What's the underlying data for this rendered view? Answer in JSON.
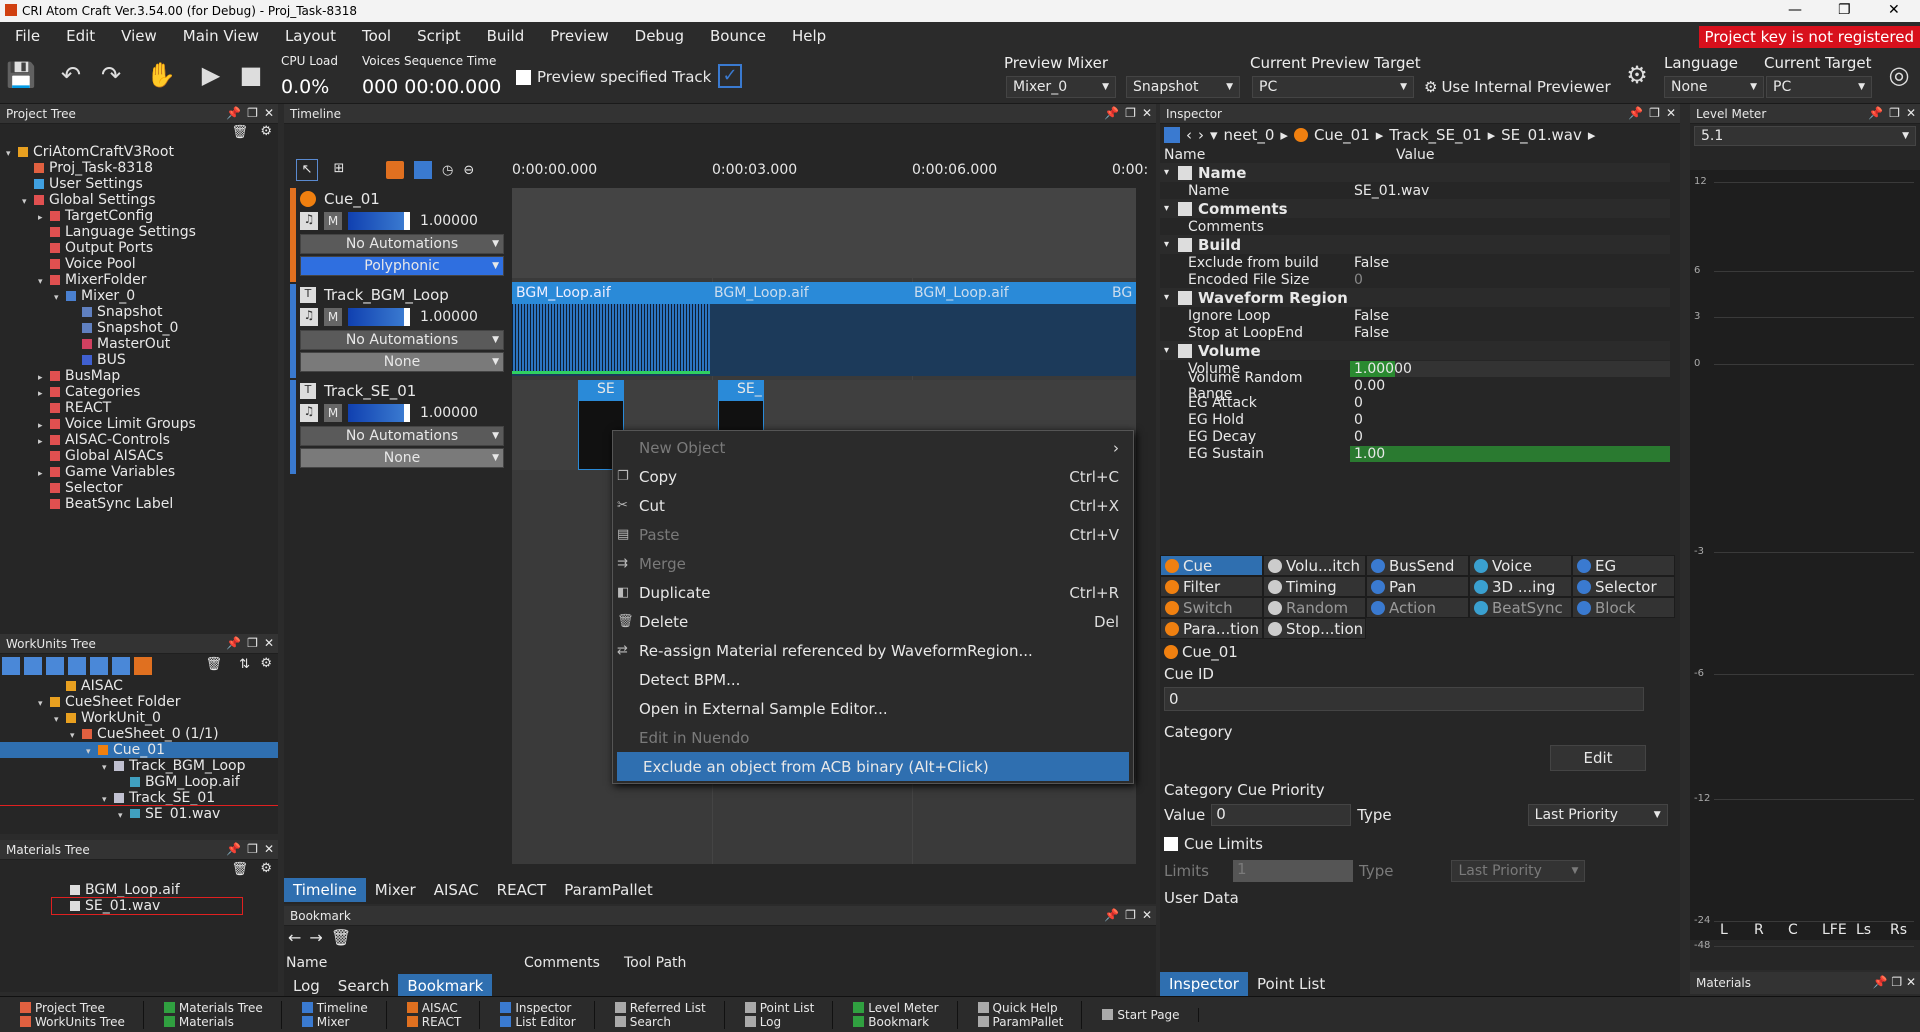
{
  "title": "CRI Atom Craft Ver.3.54.00 (for Debug) - Proj_Task-8318",
  "menu": [
    "File",
    "Edit",
    "View",
    "Main View",
    "Layout",
    "Tool",
    "Script",
    "Build",
    "Preview",
    "Debug",
    "Bounce",
    "Help"
  ],
  "warning": "Project key is not registered",
  "toolbar": {
    "cpu_label": "CPU Load",
    "cpu_value": "0.0%",
    "voices_label": "Voices Sequence Time",
    "voices_value": "000 00:00.000",
    "preview_track": "Preview specified Track",
    "preview_mixer_label": "Preview Mixer",
    "mixer": "Mixer_0",
    "snapshot": "Snapshot",
    "current_preview_label": "Current Preview Target",
    "preview_target": "PC",
    "use_internal": "Use Internal Previewer",
    "language_label": "Language",
    "language": "None",
    "current_target_label": "Current Target",
    "target": "PC"
  },
  "project_tree": {
    "title": "Project Tree",
    "items": [
      {
        "t": "CriAtomCraftV3Root",
        "lvl": 0,
        "exp": "▾",
        "c": "#e8a020"
      },
      {
        "t": "Proj_Task-8318",
        "lvl": 1,
        "exp": "",
        "c": "#e06040"
      },
      {
        "t": "User Settings",
        "lvl": 1,
        "exp": "",
        "c": "#40a0e0"
      },
      {
        "t": "Global Settings",
        "lvl": 1,
        "exp": "▾",
        "c": "#e05050"
      },
      {
        "t": "TargetConfig",
        "lvl": 2,
        "exp": "▸",
        "c": "#e05050"
      },
      {
        "t": "Language Settings",
        "lvl": 2,
        "exp": "",
        "c": "#e05050"
      },
      {
        "t": "Output Ports",
        "lvl": 2,
        "exp": "",
        "c": "#e05050"
      },
      {
        "t": "Voice Pool",
        "lvl": 2,
        "exp": "",
        "c": "#e05050"
      },
      {
        "t": "MixerFolder",
        "lvl": 2,
        "exp": "▾",
        "c": "#e05050"
      },
      {
        "t": "Mixer_0",
        "lvl": 3,
        "exp": "▾",
        "c": "#4a80d0"
      },
      {
        "t": "Snapshot",
        "lvl": 4,
        "exp": "",
        "c": "#6080c0"
      },
      {
        "t": "Snapshot_0",
        "lvl": 4,
        "exp": "",
        "c": "#6080c0"
      },
      {
        "t": "MasterOut",
        "lvl": 4,
        "exp": "",
        "c": "#d04060"
      },
      {
        "t": "BUS",
        "lvl": 4,
        "exp": "",
        "c": "#4060d0"
      },
      {
        "t": "BusMap",
        "lvl": 2,
        "exp": "▸",
        "c": "#e05050"
      },
      {
        "t": "Categories",
        "lvl": 2,
        "exp": "▸",
        "c": "#e05050"
      },
      {
        "t": "REACT",
        "lvl": 2,
        "exp": "",
        "c": "#e05050"
      },
      {
        "t": "Voice Limit Groups",
        "lvl": 2,
        "exp": "▸",
        "c": "#e05050"
      },
      {
        "t": "AISAC-Controls",
        "lvl": 2,
        "exp": "▸",
        "c": "#e05050"
      },
      {
        "t": "Global AISACs",
        "lvl": 2,
        "exp": "",
        "c": "#e05050"
      },
      {
        "t": "Game Variables",
        "lvl": 2,
        "exp": "▸",
        "c": "#e05050"
      },
      {
        "t": "Selector",
        "lvl": 2,
        "exp": "",
        "c": "#e05050"
      },
      {
        "t": "BeatSync Label",
        "lvl": 2,
        "exp": "",
        "c": "#e05050"
      }
    ]
  },
  "workunits_tree": {
    "title": "WorkUnits Tree",
    "items": [
      {
        "t": "AISAC",
        "lvl": 3,
        "exp": "",
        "c": "#e8a020",
        "sel": false
      },
      {
        "t": "CueSheet Folder",
        "lvl": 2,
        "exp": "▾",
        "c": "#e8a020",
        "sel": false
      },
      {
        "t": "WorkUnit_0",
        "lvl": 3,
        "exp": "▾",
        "c": "#e8a020",
        "sel": false
      },
      {
        "t": "CueSheet_0 (1/1)",
        "lvl": 4,
        "exp": "▾",
        "c": "#e06040",
        "sel": false
      },
      {
        "t": "Cue_01",
        "lvl": 5,
        "exp": "▾",
        "c": "#f08010",
        "sel": true
      },
      {
        "t": "Track_BGM_Loop",
        "lvl": 6,
        "exp": "▾",
        "c": "#c0c0d0",
        "sel": false
      },
      {
        "t": "BGM_Loop.aif",
        "lvl": 7,
        "exp": "",
        "c": "#40a0c0",
        "sel": false
      },
      {
        "t": "Track_SE_01",
        "lvl": 6,
        "exp": "▾",
        "c": "#c0c0d0",
        "sel": false
      },
      {
        "t": "SE_01.wav",
        "lvl": 7,
        "exp": "▾",
        "c": "#40a0c0",
        "sel": false
      }
    ]
  },
  "materials_tree": {
    "title": "Materials Tree",
    "items": [
      "BGM_Loop.aif",
      "SE_01.wav"
    ]
  },
  "timeline": {
    "title": "Timeline",
    "times": [
      "0:00:00.000",
      "0:00:03.000",
      "0:00:06.000",
      "0:00:"
    ],
    "tracks": [
      {
        "name": "Cue_01",
        "vol": "1.00000",
        "auto": "No Automations",
        "mode": "Polyphonic"
      },
      {
        "name": "Track_BGM_Loop",
        "vol": "1.00000",
        "auto": "No Automations",
        "mode": "None"
      },
      {
        "name": "Track_SE_01",
        "vol": "1.00000",
        "auto": "No Automations",
        "mode": "None"
      }
    ],
    "clips": [
      "BGM_Loop.aif",
      "BGM_Loop.aif",
      "BGM_Loop.aif",
      "BG"
    ],
    "se_clips": [
      "SE",
      "SE_"
    ],
    "mute": "M",
    "tabs": [
      "Timeline",
      "Mixer",
      "AISAC",
      "REACT",
      "ParamPallet"
    ]
  },
  "context_menu": [
    {
      "label": "New Object",
      "sc": "›",
      "dis": true,
      "ic": ""
    },
    {
      "label": "Copy",
      "sc": "Ctrl+C",
      "dis": false,
      "ic": "❐"
    },
    {
      "label": "Cut",
      "sc": "Ctrl+X",
      "dis": false,
      "ic": "✂"
    },
    {
      "label": "Paste",
      "sc": "Ctrl+V",
      "dis": true,
      "ic": "▤"
    },
    {
      "label": "Merge",
      "sc": "",
      "dis": true,
      "ic": "⇉"
    },
    {
      "label": "Duplicate",
      "sc": "Ctrl+R",
      "dis": false,
      "ic": "◧"
    },
    {
      "label": "Delete",
      "sc": "Del",
      "dis": false,
      "ic": "🗑"
    },
    {
      "label": "Re-assign Material referenced by WaveformRegion...",
      "sc": "",
      "dis": false,
      "ic": "⇄"
    },
    {
      "label": "Detect BPM...",
      "sc": "",
      "dis": false,
      "ic": ""
    },
    {
      "label": "Open in External Sample Editor...",
      "sc": "",
      "dis": false,
      "ic": ""
    },
    {
      "label": "Edit in Nuendo",
      "sc": "",
      "dis": true,
      "ic": ""
    },
    {
      "label": "Exclude an object from ACB binary (Alt+Click)",
      "sc": "",
      "dis": false,
      "ic": "",
      "hl": true
    }
  ],
  "bookmark": {
    "title": "Bookmark",
    "cols": [
      "Name",
      "Comments",
      "Tool Path"
    ],
    "tabs": [
      "Log",
      "Search",
      "Bookmark"
    ]
  },
  "inspector": {
    "title": "Inspector",
    "crumbs": [
      "neet_0",
      "Cue_01",
      "Track_SE_01",
      "SE_01.wav"
    ],
    "col_name": "Name",
    "col_value": "Value",
    "sections": [
      {
        "h": "Name",
        "rows": [
          [
            "Name",
            "SE_01.wav",
            ""
          ]
        ]
      },
      {
        "h": "Comments",
        "rows": [
          [
            "Comments",
            "",
            ""
          ]
        ]
      },
      {
        "h": "Build",
        "rows": [
          [
            "Exclude from build",
            "False",
            ""
          ],
          [
            "Encoded File Size",
            "0",
            "dim"
          ]
        ]
      },
      {
        "h": "Waveform Region",
        "rows": [
          [
            "Ignore Loop",
            "False",
            ""
          ],
          [
            "Stop at LoopEnd",
            "False",
            ""
          ]
        ]
      },
      {
        "h": "Volume",
        "rows": [
          [
            "Volume",
            "1.00000",
            "green"
          ],
          [
            "Volume Random Range",
            "0.00",
            ""
          ],
          [
            "EG Attack",
            "0",
            ""
          ],
          [
            "EG Hold",
            "0",
            ""
          ],
          [
            "EG Decay",
            "0",
            ""
          ],
          [
            "EG Sustain",
            "1.00",
            "green2"
          ]
        ]
      }
    ],
    "cats": [
      [
        "Cue",
        "Volu...itch",
        "BusSend",
        "Voice",
        "EG"
      ],
      [
        "Filter",
        "Timing",
        "Pan",
        "3D ...ing",
        "Selector"
      ],
      [
        "Switch",
        "Random",
        "Action",
        "BeatSync",
        "Block"
      ],
      [
        "Para...tion",
        "Stop...tion",
        "",
        "",
        ""
      ]
    ],
    "cue_name": "Cue_01",
    "cue_id_label": "Cue ID",
    "cue_id": "0",
    "category_label": "Category",
    "edit": "Edit",
    "cat_priority_label": "Category Cue Priority",
    "value_label": "Value",
    "value": "0",
    "type_label": "Type",
    "type": "Last Priority",
    "cue_limits": "Cue Limits",
    "limits_label": "Limits",
    "limits": "1",
    "type2": "Last Priority",
    "user_data": "User Data",
    "tabs": [
      "Inspector",
      "Point List"
    ]
  },
  "level_meter": {
    "title": "Level Meter",
    "mode": "5.1",
    "ticks": [
      "12",
      "6",
      "3",
      "0",
      "-3",
      "-6",
      "-12",
      "-24",
      "-48"
    ],
    "channels": [
      "L",
      "R",
      "C",
      "LFE",
      "Ls",
      "Rs"
    ]
  },
  "materials_panel": "Materials",
  "bottom": [
    [
      "Project Tree",
      "WorkUnits Tree"
    ],
    [
      "Materials Tree",
      "Materials"
    ],
    [
      "Timeline",
      "Mixer"
    ],
    [
      "AISAC",
      "REACT"
    ],
    [
      "Inspector",
      "List Editor"
    ],
    [
      "Referred List",
      "Search"
    ],
    [
      "Point List",
      "Log"
    ],
    [
      "Level Meter",
      "Bookmark"
    ],
    [
      "Quick Help",
      "ParamPallet"
    ],
    [
      "Start Page",
      ""
    ]
  ]
}
